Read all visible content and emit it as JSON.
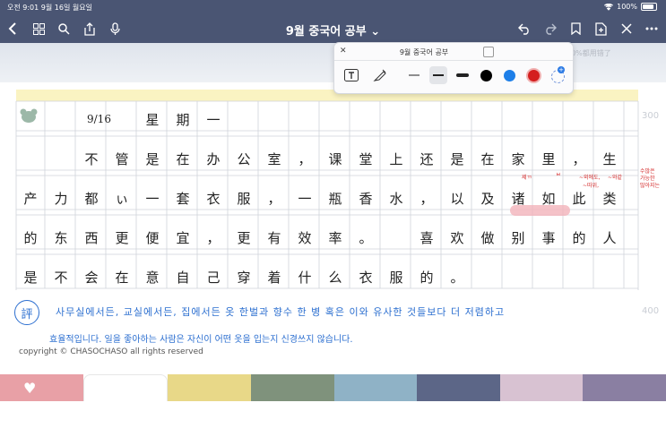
{
  "status_bar": {
    "time_date": "오전 9:01   9월 16일 월요일",
    "battery": "100%"
  },
  "nav": {
    "title": "9월 중국어 공부 ⌄"
  },
  "tab_ghost": "你的时间80%都用错了",
  "popup": {
    "title": "9월 중국어 공부",
    "close": "✕"
  },
  "note": {
    "date": "9/16",
    "row0": [
      "星",
      "期",
      "一"
    ],
    "row1": [
      "不",
      "管",
      "是",
      "在",
      "办",
      "公",
      "室",
      "，",
      "课",
      "堂",
      "上",
      "还",
      "是",
      "在",
      "家",
      "里",
      "，",
      "生"
    ],
    "row2": [
      "产",
      "力",
      "都",
      "ぃ",
      "一",
      "套",
      "衣",
      "服",
      "，",
      "一",
      "瓶",
      "香",
      "水",
      "，",
      "以",
      "及",
      "诸",
      "如",
      "此",
      "类"
    ],
    "row3": [
      "的",
      "东",
      "西",
      "更",
      "便",
      "宜",
      "，",
      "更",
      "有",
      "效",
      "率",
      "。",
      "",
      "喜",
      "欢",
      "做",
      "别",
      "事",
      "的",
      "人"
    ],
    "row4": [
      "是",
      "不",
      "会",
      "在",
      "意",
      "自",
      "己",
      "穿",
      "着",
      "什",
      "么",
      "衣",
      "服",
      "的",
      "。"
    ],
    "ruler_300": "300",
    "ruler_400": "400",
    "red_notes": [
      "제ㄲ",
      "ㅂ",
      "~외에도,",
      "~와같",
      "~따위,",
      "수많은",
      "가능한",
      "많아지는"
    ],
    "comment_mark": "評",
    "blue_line1": "사무실에서든, 교실에서든, 집에서든 옷 한벌과 향수 한 병 혹은 이와 유사한 것들보다 더 저렴하고",
    "blue_line2": "효율적입니다. 일을 좋아하는 사람은 자신이 어떤 옷을 입는지 신경쓰지 않습니다.",
    "copyright": "copyright © CHASOCHASO all rights reserved"
  },
  "colors": {
    "nav": "#4a5573",
    "ink_blue": "#2c6fd0",
    "ink_red": "#d42a2a",
    "highlight": "#f3b3ba",
    "swatches": [
      "#e8a0a6",
      "#ffffff",
      "#e8d888",
      "#7f927c",
      "#8fb2c6",
      "#5c6687",
      "#d8c2d2",
      "#8a7fa2"
    ]
  },
  "icons": [
    "back-icon",
    "grid-icon",
    "search-icon",
    "share-icon",
    "mic-icon",
    "undo-icon",
    "redo-icon",
    "bookmark-icon",
    "add-page-icon",
    "close-icon",
    "more-icon",
    "text-tool-icon",
    "pen-tool-icon",
    "heart-icon",
    "mouse-icon"
  ]
}
